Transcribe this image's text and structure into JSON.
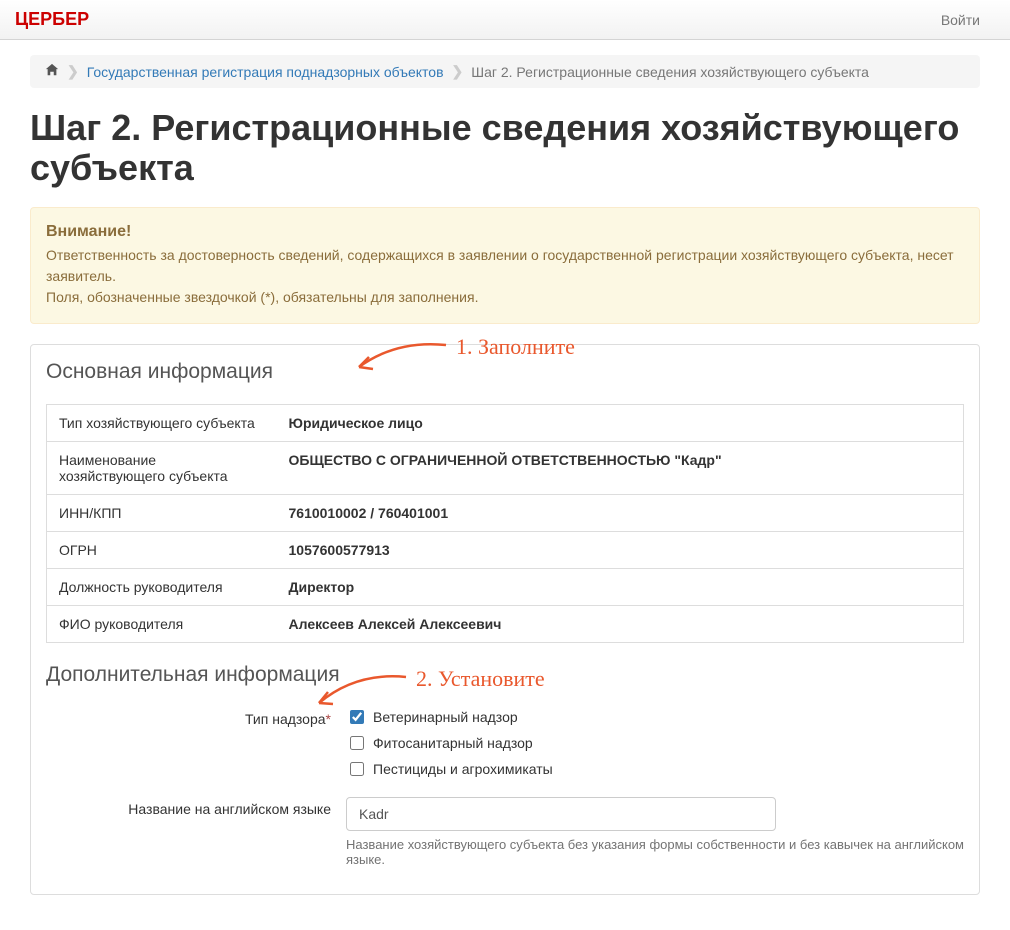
{
  "navbar": {
    "brand": "ЦЕРБЕР",
    "login": "Войти"
  },
  "breadcrumb": {
    "item1": "Государственная регистрация поднадзорных объектов",
    "active": "Шаг 2. Регистрационные сведения хозяйствующего субъекта"
  },
  "page": {
    "title": "Шаг 2. Регистрационные сведения хозяйствующего субъекта"
  },
  "alert": {
    "title": "Внимание!",
    "line1": "Ответственность за достоверность сведений, содержащихся в заявлении о государственной регистрации хозяйствующего субъекта, несет заявитель.",
    "line2": "Поля, обозначенные звездочкой (*), обязательны для заполнения."
  },
  "sections": {
    "main_info": "Основная информация",
    "extra_info": "Дополнительная информация"
  },
  "info_rows": [
    {
      "label": "Тип хозяйствующего субъекта",
      "value": "Юридическое лицо"
    },
    {
      "label": "Наименование хозяйствующего субъекта",
      "value": "ОБЩЕСТВО С ОГРАНИЧЕННОЙ ОТВЕТСТВЕННОСТЬЮ \"Кадр\""
    },
    {
      "label": "ИНН/КПП",
      "value": "7610010002 / 760401001"
    },
    {
      "label": "ОГРН",
      "value": "1057600577913"
    },
    {
      "label": "Должность руководителя",
      "value": "Директор"
    },
    {
      "label": "ФИО руководителя",
      "value": "Алексеев Алексей Алексеевич"
    }
  ],
  "form": {
    "supervision_type_label": "Тип надзора",
    "supervision_options": {
      "opt1": "Ветеринарный надзор",
      "opt2": "Фитосанитарный надзор",
      "opt3": "Пестициды и агрохимикаты"
    },
    "english_name_label": "Название на английском языке",
    "english_name_value": "Kadr",
    "english_name_help": "Название хозяйствующего субъекта без указания формы собственности и без кавычек на английском языке."
  },
  "annotations": {
    "a1": "1. Заполните",
    "a2": "2. Установите"
  }
}
